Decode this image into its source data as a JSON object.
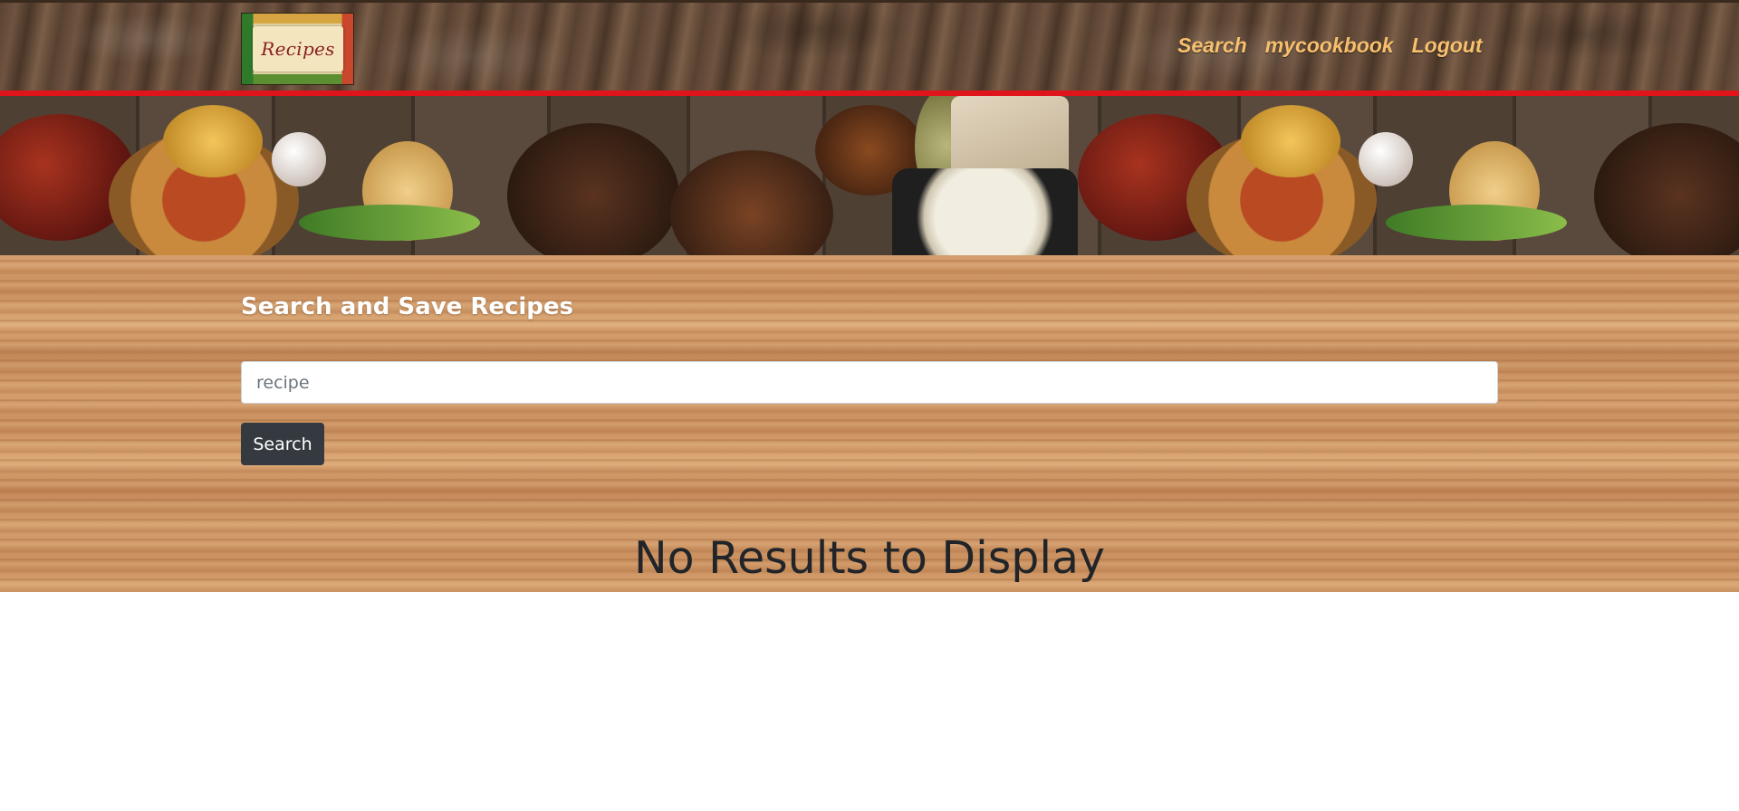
{
  "navbar": {
    "brand_text": "Recipes",
    "links": [
      {
        "label": "Search"
      },
      {
        "label": "mycookbook"
      },
      {
        "label": "Logout"
      }
    ],
    "accent_color": "#e0141b",
    "link_color": "#f7c06d"
  },
  "main": {
    "title": "Search and Save Recipes",
    "search_placeholder": "recipe",
    "search_value": "",
    "search_button_label": "Search",
    "empty_message": "No Results to Display"
  }
}
